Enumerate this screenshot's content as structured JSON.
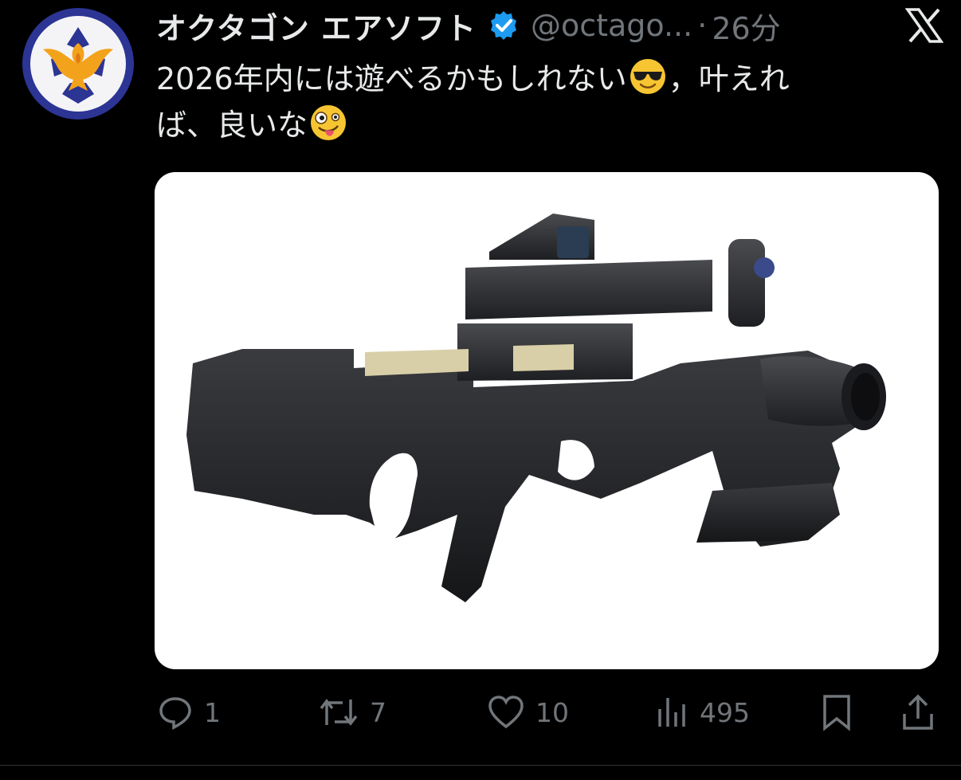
{
  "tweet": {
    "author_name": "オクタゴン エアソフト",
    "handle": "@octago...",
    "separator": "·",
    "time": "26分",
    "text_line1": "2026年内には遊べるかもしれない",
    "text_after_emoji1": "，叶えれ",
    "text_line2": "ば、良いな",
    "emoji1": "smiling-face-with-sunglasses",
    "emoji2": "zany-face"
  },
  "actions": {
    "replies": "1",
    "retweets": "7",
    "likes": "10",
    "views": "495"
  },
  "colors": {
    "background": "#000000",
    "text": "#e7e9ea",
    "muted": "#71767b",
    "verified": "#1d9bf0"
  }
}
